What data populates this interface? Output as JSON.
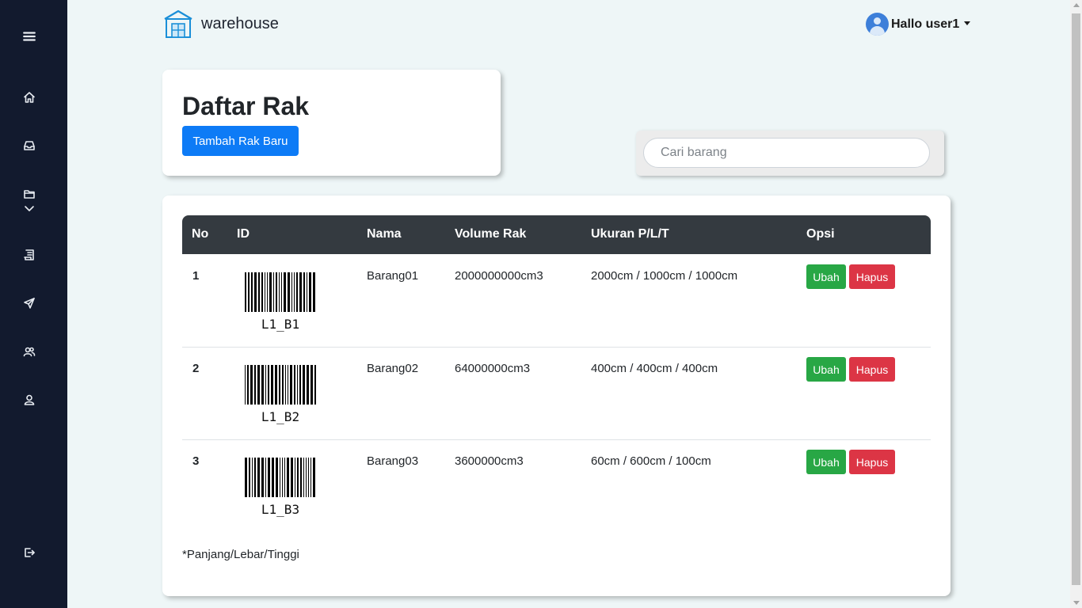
{
  "brand": {
    "name": "warehouse",
    "icon": "warehouse-icon",
    "accent": "#1a8fd8"
  },
  "user": {
    "greeting": "Hallo user1"
  },
  "sidebar": {
    "icons": [
      "menu-icon",
      "home-icon",
      "inbox-icon",
      "folder-icon",
      "chevron-down-icon",
      "document-icon",
      "send-icon",
      "users-icon",
      "user-icon",
      "logout-icon"
    ]
  },
  "title_card": {
    "heading": "Daftar Rak",
    "add_button": "Tambah Rak Baru"
  },
  "search": {
    "placeholder": "Cari barang",
    "value": ""
  },
  "table": {
    "headers": {
      "no": "No",
      "id": "ID",
      "nama": "Nama",
      "volume": "Volume Rak",
      "ukuran": "Ukuran P/L/T",
      "opsi": "Opsi"
    },
    "rows": [
      {
        "no": "1",
        "barcode": "L1_B1",
        "nama": "Barang01",
        "volume": "2000000000cm3",
        "ukuran": "2000cm / 1000cm / 1000cm",
        "edit": "Ubah",
        "delete": "Hapus"
      },
      {
        "no": "2",
        "barcode": "L1_B2",
        "nama": "Barang02",
        "volume": "64000000cm3",
        "ukuran": "400cm / 400cm / 400cm",
        "edit": "Ubah",
        "delete": "Hapus"
      },
      {
        "no": "3",
        "barcode": "L1_B3",
        "nama": "Barang03",
        "volume": "3600000cm3",
        "ukuran": "60cm / 600cm / 100cm",
        "edit": "Ubah",
        "delete": "Hapus"
      }
    ],
    "note": "*Panjang/Lebar/Tinggi"
  },
  "colors": {
    "sidebar": "#121a2e",
    "primary": "#0d7bf6",
    "success": "#28a745",
    "danger": "#dc3545",
    "table_header": "#343a40",
    "page_bg": "#eef6f7"
  }
}
